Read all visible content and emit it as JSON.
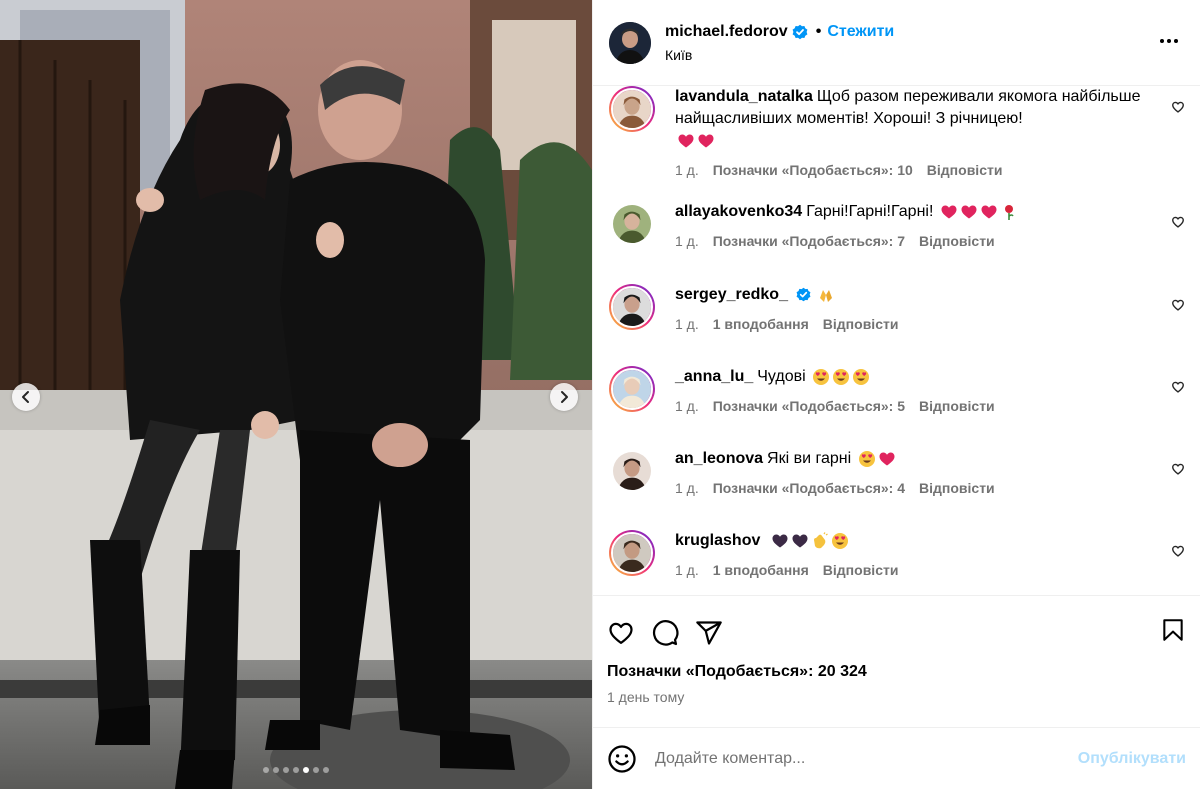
{
  "header": {
    "username": "michael.fedorov",
    "separator": "•",
    "follow_label": "Стежити",
    "location": "Київ"
  },
  "carousel": {
    "slide_count": 7,
    "active_index": 4
  },
  "comments": [
    {
      "username": "lavandula_natalka",
      "text": "Щоб разом переживали якомога найбільше найщасливіших моментів! Хороші! З річницею!",
      "emojis": [
        "heart",
        "heart"
      ],
      "emoji_newline": true,
      "time": "1 д.",
      "likes": "Позначки «Подобається»: 10",
      "reply": "Відповісти",
      "ring": true,
      "verified": false
    },
    {
      "username": "allayakovenko34",
      "text": "Гарні!Гарні!Гарні!",
      "emojis": [
        "heart",
        "heart",
        "heart",
        "rose"
      ],
      "time": "1 д.",
      "likes": "Позначки «Подобається»: 7",
      "reply": "Відповісти",
      "ring": false,
      "verified": false
    },
    {
      "username": "sergey_redko_",
      "text": "",
      "emojis": [
        "pray"
      ],
      "time": "1 д.",
      "likes": "1 вподобання",
      "reply": "Відповісти",
      "ring": true,
      "verified": true
    },
    {
      "username": "_anna_lu_",
      "text": "Чудові",
      "emojis": [
        "heart-eyes",
        "heart-eyes",
        "heart-eyes"
      ],
      "time": "1 д.",
      "likes": "Позначки «Подобається»: 5",
      "reply": "Відповісти",
      "ring": true,
      "verified": false
    },
    {
      "username": "an_leonova",
      "text": "Які ви гарні",
      "emojis": [
        "heart-eyes",
        "heart"
      ],
      "time": "1 д.",
      "likes": "Позначки «Подобається»: 4",
      "reply": "Відповісти",
      "ring": false,
      "verified": false
    },
    {
      "username": "kruglashov",
      "text": "",
      "emojis": [
        "black-heart",
        "black-heart",
        "clap",
        "heart-eyes"
      ],
      "time": "1 д.",
      "likes": "1 вподобання",
      "reply": "Відповісти",
      "ring": true,
      "verified": false
    }
  ],
  "post": {
    "likes": "Позначки «Подобається»: 20 324",
    "date": "1 день тому"
  },
  "composer": {
    "placeholder": "Додайте коментар...",
    "publish_label": "Опублікувати"
  },
  "icons": {
    "verified": "verified-badge-icon",
    "more": "more-options-icon",
    "like": "heart-outline-icon",
    "comment": "comment-bubble-icon",
    "share": "paper-plane-icon",
    "save": "bookmark-icon",
    "emoji": "emoji-smile-icon",
    "prev": "chevron-left-icon",
    "next": "chevron-right-icon"
  },
  "colors": {
    "accent": "#0095f6",
    "publish_disabled": "#b2dffc",
    "muted_text": "#737373",
    "verified_blue": "#0095f6",
    "heart_red": "#e0245e"
  }
}
